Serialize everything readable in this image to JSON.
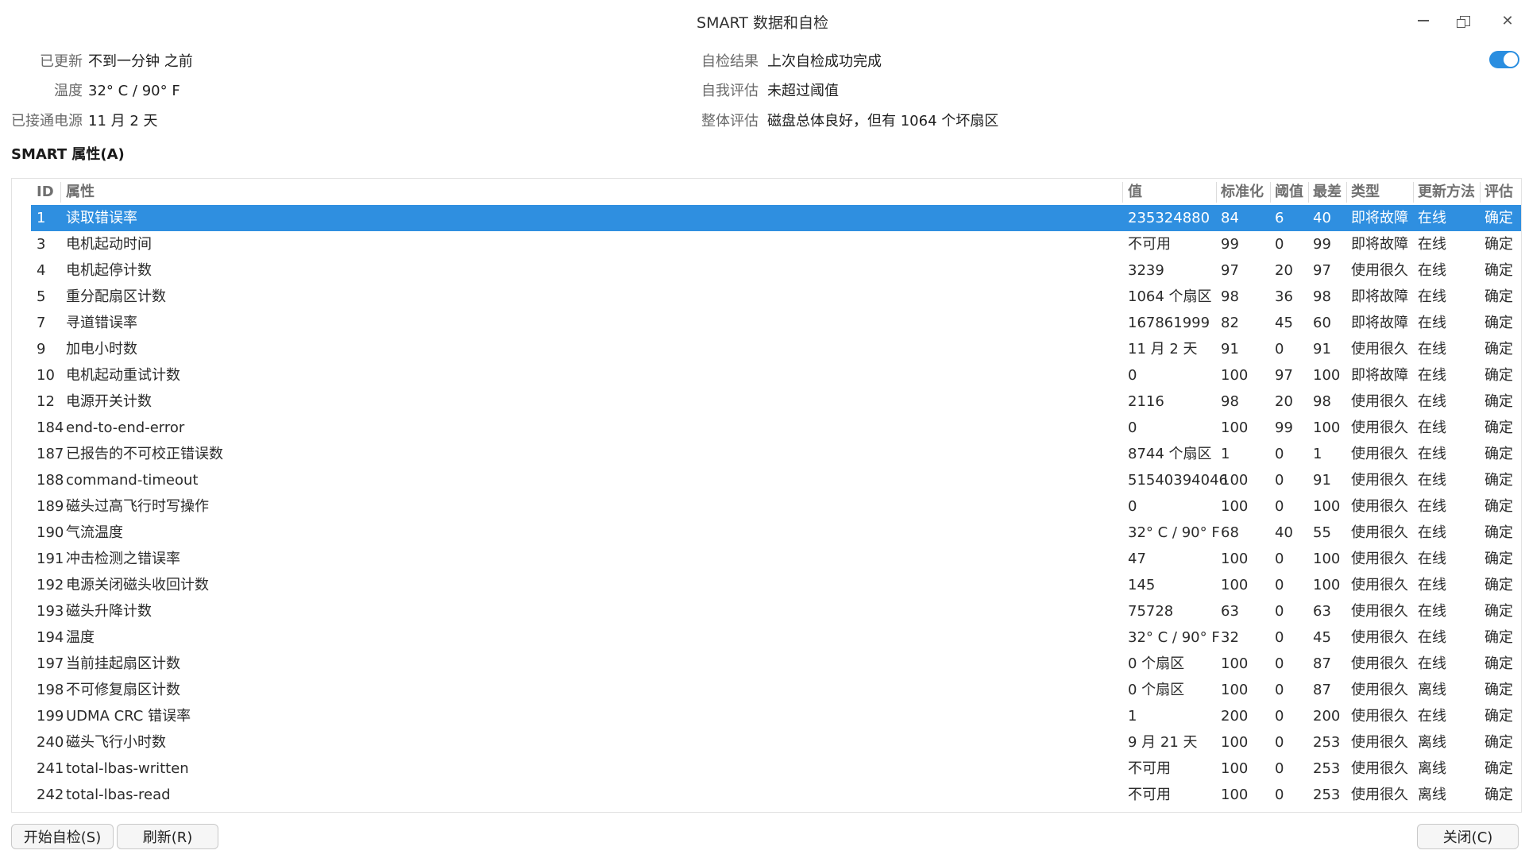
{
  "window": {
    "title": "SMART 数据和自检"
  },
  "info_left": [
    {
      "label": "已更新",
      "value": "不到一分钟 之前"
    },
    {
      "label": "温度",
      "value": "32° C / 90° F"
    },
    {
      "label": "已接通电源",
      "value": "11 月 2 天"
    }
  ],
  "info_right": [
    {
      "label": "自检结果",
      "value": "上次自检成功完成"
    },
    {
      "label": "自我评估",
      "value": "未超过阈值"
    },
    {
      "label": "整体评估",
      "value": "磁盘总体良好，但有 1064 个坏扇区"
    }
  ],
  "toggle": {
    "on": true
  },
  "section_title": "SMART 属性(A)",
  "table": {
    "headers": [
      "ID",
      "属性",
      "值",
      "标准化",
      "阈值",
      "最差",
      "类型",
      "更新方法",
      "评估"
    ],
    "selected_row": 0,
    "rows": [
      [
        "1",
        "读取错误率",
        "235324880",
        "84",
        "6",
        "40",
        "即将故障",
        "在线",
        "确定"
      ],
      [
        "3",
        "电机起动时间",
        "不可用",
        "99",
        "0",
        "99",
        "即将故障",
        "在线",
        "确定"
      ],
      [
        "4",
        "电机起停计数",
        "3239",
        "97",
        "20",
        "97",
        "使用很久",
        "在线",
        "确定"
      ],
      [
        "5",
        "重分配扇区计数",
        "1064 个扇区",
        "98",
        "36",
        "98",
        "即将故障",
        "在线",
        "确定"
      ],
      [
        "7",
        "寻道错误率",
        "167861999",
        "82",
        "45",
        "60",
        "即将故障",
        "在线",
        "确定"
      ],
      [
        "9",
        "加电小时数",
        "11 月 2 天",
        "91",
        "0",
        "91",
        "使用很久",
        "在线",
        "确定"
      ],
      [
        "10",
        "电机起动重试计数",
        "0",
        "100",
        "97",
        "100",
        "即将故障",
        "在线",
        "确定"
      ],
      [
        "12",
        "电源开关计数",
        "2116",
        "98",
        "20",
        "98",
        "使用很久",
        "在线",
        "确定"
      ],
      [
        "184",
        "end-to-end-error",
        "0",
        "100",
        "99",
        "100",
        "使用很久",
        "在线",
        "确定"
      ],
      [
        "187",
        "已报告的不可校正错误数",
        "8744 个扇区",
        "1",
        "0",
        "1",
        "使用很久",
        "在线",
        "确定"
      ],
      [
        "188",
        "command-timeout",
        "51540394046",
        "100",
        "0",
        "91",
        "使用很久",
        "在线",
        "确定"
      ],
      [
        "189",
        "磁头过高飞行时写操作",
        "0",
        "100",
        "0",
        "100",
        "使用很久",
        "在线",
        "确定"
      ],
      [
        "190",
        "气流温度",
        "32° C / 90° F",
        "68",
        "40",
        "55",
        "使用很久",
        "在线",
        "确定"
      ],
      [
        "191",
        "冲击检测之错误率",
        "47",
        "100",
        "0",
        "100",
        "使用很久",
        "在线",
        "确定"
      ],
      [
        "192",
        "电源关闭磁头收回计数",
        "145",
        "100",
        "0",
        "100",
        "使用很久",
        "在线",
        "确定"
      ],
      [
        "193",
        "磁头升降计数",
        "75728",
        "63",
        "0",
        "63",
        "使用很久",
        "在线",
        "确定"
      ],
      [
        "194",
        "温度",
        "32° C / 90° F",
        "32",
        "0",
        "45",
        "使用很久",
        "在线",
        "确定"
      ],
      [
        "197",
        "当前挂起扇区计数",
        "0 个扇区",
        "100",
        "0",
        "87",
        "使用很久",
        "在线",
        "确定"
      ],
      [
        "198",
        "不可修复扇区计数",
        "0 个扇区",
        "100",
        "0",
        "87",
        "使用很久",
        "离线",
        "确定"
      ],
      [
        "199",
        "UDMA CRC 错误率",
        "1",
        "200",
        "0",
        "200",
        "使用很久",
        "在线",
        "确定"
      ],
      [
        "240",
        "磁头飞行小时数",
        "9 月 21 天",
        "100",
        "0",
        "253",
        "使用很久",
        "离线",
        "确定"
      ],
      [
        "241",
        "total-lbas-written",
        "不可用",
        "100",
        "0",
        "253",
        "使用很久",
        "离线",
        "确定"
      ],
      [
        "242",
        "total-lbas-read",
        "不可用",
        "100",
        "0",
        "253",
        "使用很久",
        "离线",
        "确定"
      ]
    ]
  },
  "buttons": {
    "start_selftest": "开始自检(S)",
    "refresh": "刷新(R)",
    "close": "关闭(C)"
  }
}
